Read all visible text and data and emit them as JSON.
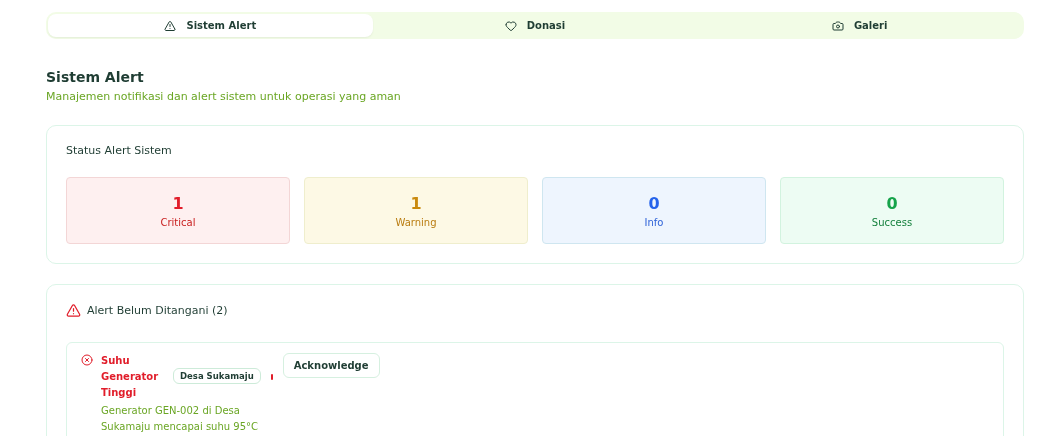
{
  "tabs": [
    {
      "label": "Sistem Alert",
      "kind": "alert",
      "selected": true
    },
    {
      "label": "Donasi",
      "kind": "heart",
      "selected": false
    },
    {
      "label": "Galeri",
      "kind": "camera",
      "selected": false
    }
  ],
  "header": {
    "title": "Sistem Alert",
    "subtitle": "Manajemen notifikasi dan alert sistem untuk operasi yang aman"
  },
  "status_card": {
    "title": "Status Alert Sistem",
    "stats": [
      {
        "kind": "critical",
        "count": "1",
        "label": "Critical"
      },
      {
        "kind": "warning",
        "count": "1",
        "label": "Warning"
      },
      {
        "kind": "info",
        "count": "0",
        "label": "Info"
      },
      {
        "kind": "success",
        "count": "0",
        "label": "Success"
      }
    ]
  },
  "alerts_card": {
    "title": "Alert Belum Ditangani (2)",
    "alerts": [
      {
        "kind": "critical",
        "title": "Suhu Generator Tinggi",
        "location": "Desa Sukamaju",
        "description": "Generator GEN-002 di Desa Sukamaju mencapai suhu 95°C",
        "action": "Acknowledge"
      }
    ]
  }
}
